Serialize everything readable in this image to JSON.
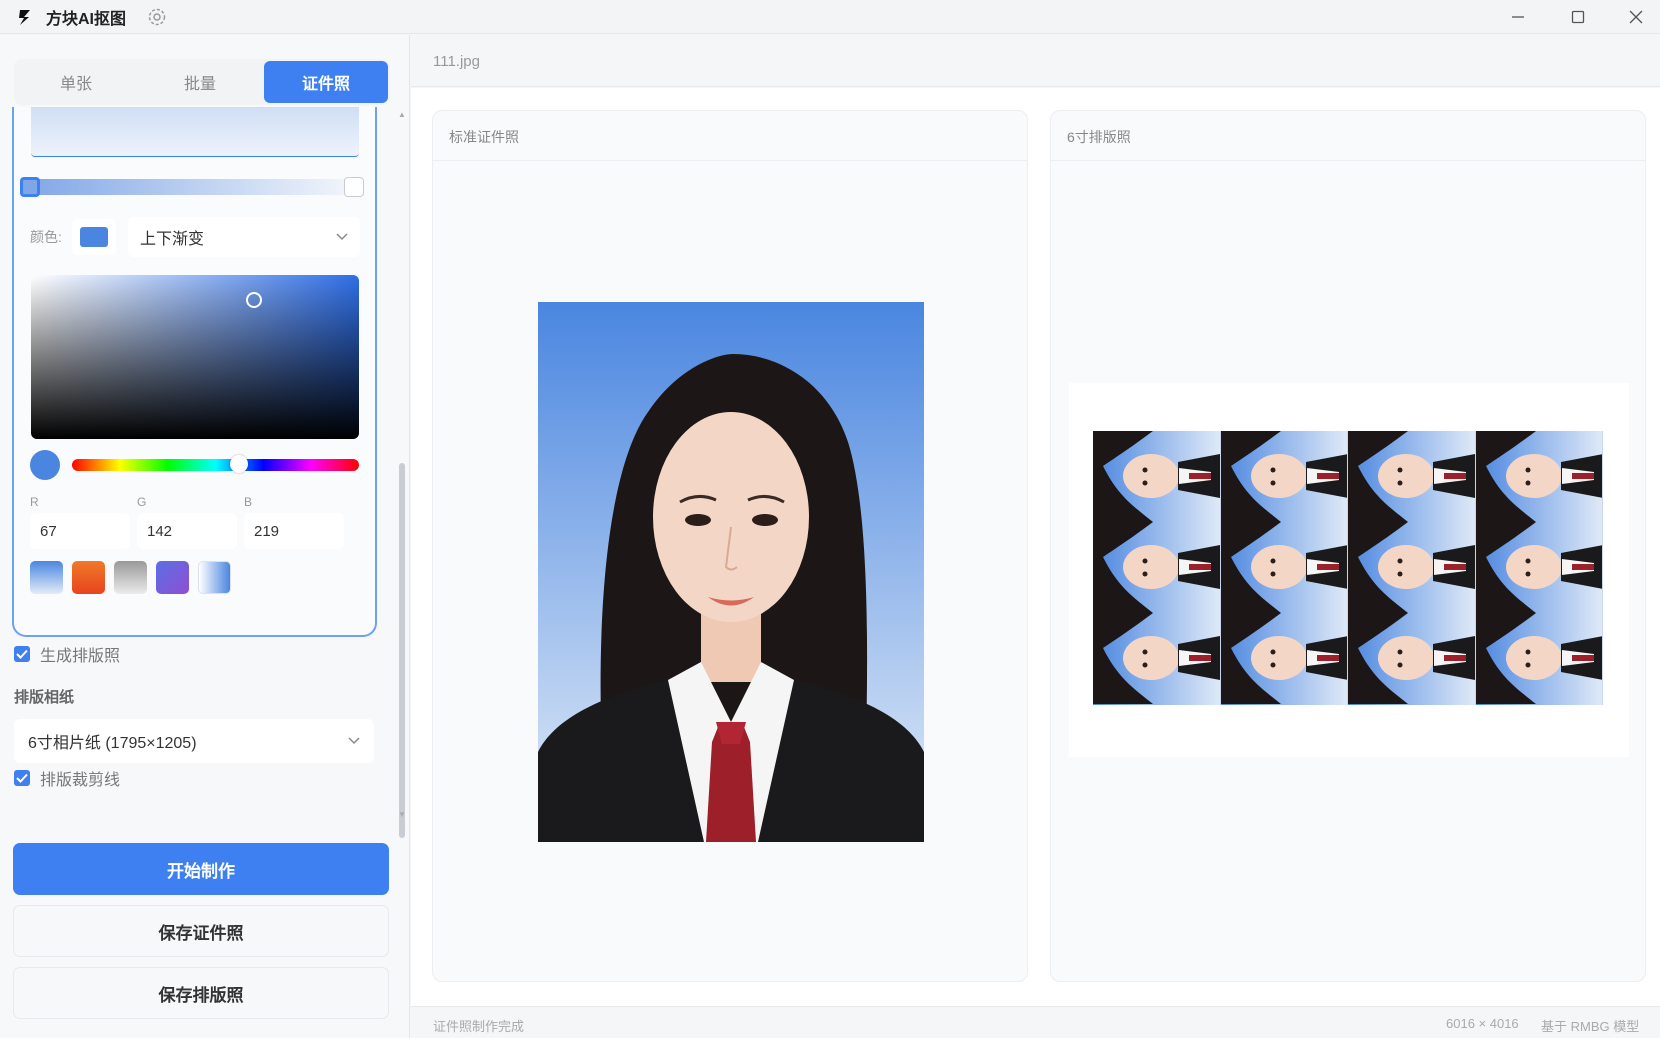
{
  "app": {
    "title": "方块AI抠图"
  },
  "tabs": [
    {
      "label": "单张",
      "active": false
    },
    {
      "label": "批量",
      "active": false
    },
    {
      "label": "证件照",
      "active": true
    }
  ],
  "background": {
    "color_label": "颜色:",
    "color_hex": "#4a86e0",
    "gradient_mode": "上下渐变",
    "rgb_labels": {
      "r": "R",
      "g": "G",
      "b": "B"
    },
    "rgb": {
      "r": "67",
      "g": "142",
      "b": "219"
    },
    "presets": [
      "blue-gradient",
      "orange-gradient",
      "gray-gradient",
      "purple-gradient",
      "white-blue-gradient"
    ]
  },
  "options": {
    "generate_layout_label": "生成排版照",
    "generate_layout_checked": true,
    "paper_section_label": "排版相纸",
    "paper_value": "6寸相片纸 (1795×1205)",
    "cut_lines_label": "排版裁剪线",
    "cut_lines_checked": true
  },
  "buttons": {
    "start": "开始制作",
    "save_id": "保存证件照",
    "save_layout": "保存排版照"
  },
  "file": {
    "name": "111.jpg"
  },
  "panels": {
    "standard_title": "标准证件照",
    "layout_title": "6寸排版照"
  },
  "layout_grid": {
    "columns": 4,
    "rows": 3
  },
  "status": {
    "message": "证件照制作完成",
    "size": "6016 × 4016",
    "model": "基于 RMBG 模型"
  },
  "colors": {
    "accent": "#3e7ff2",
    "photo_bg_top": "#4a86e0",
    "photo_bg_bottom": "#e3ecf8"
  }
}
